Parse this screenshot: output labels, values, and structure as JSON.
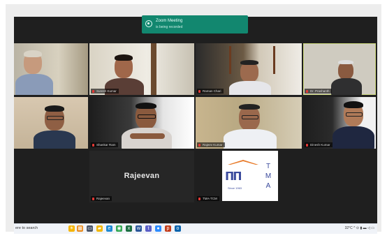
{
  "recording_banner": {
    "line1": "Zoom Meeting",
    "line2": "is being recorded"
  },
  "participants": [
    {
      "name": ""
    },
    {
      "name": "Suresh Kumar"
    },
    {
      "name": "Raman Chari"
    },
    {
      "name": "Dr. Prashanth"
    },
    {
      "name": ""
    },
    {
      "name": "Shankar Ram"
    },
    {
      "name": "Rajeev Kumar"
    },
    {
      "name": "Dinesh Kumar"
    },
    {
      "name": "Rajeevan",
      "display_name": "Rajeevan"
    },
    {
      "name": "TMA-TCM"
    }
  ],
  "logo": {
    "mark": "ᴨᴨ",
    "subtitle": "Since 1963",
    "letters": [
      "T",
      "M",
      "A"
    ]
  },
  "taskbar": {
    "search_text": "ere to search",
    "tray_text": "32°C ^ ⊙ ▮ ▬ ◁ ▭"
  },
  "colors": {
    "banner": "#12876f",
    "meeting_bg": "#1f1f1f",
    "active_border": "#c9d67a",
    "logo_blue": "#3a4a9c",
    "logo_orange": "#e87b2a"
  }
}
